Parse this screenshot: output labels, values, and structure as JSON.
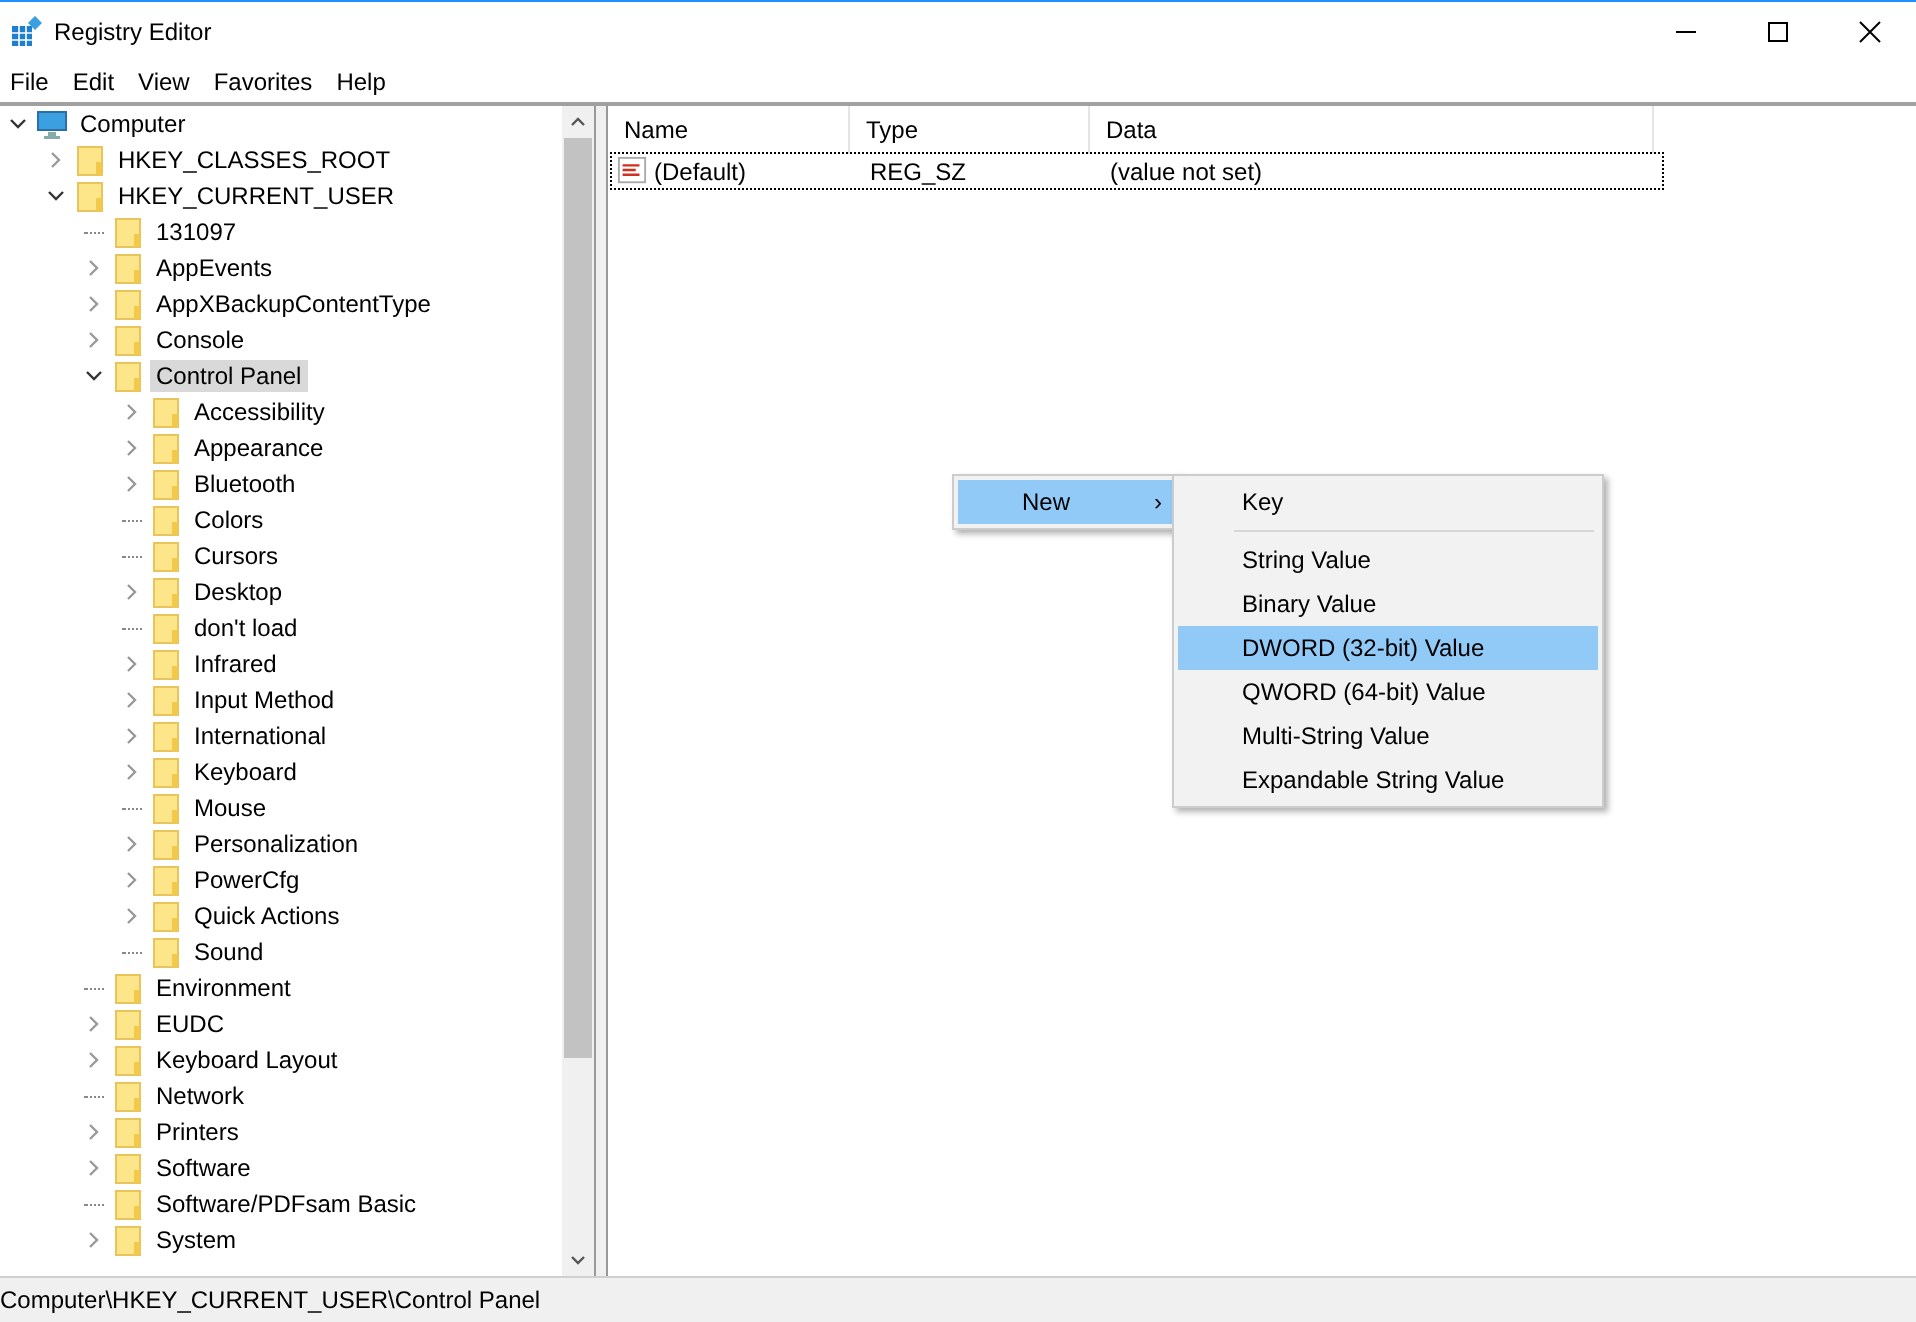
{
  "window": {
    "title": "Registry Editor"
  },
  "menu_bar": [
    "File",
    "Edit",
    "View",
    "Favorites",
    "Help"
  ],
  "tree": [
    {
      "label": "Computer",
      "kind": "computer",
      "expanded": true,
      "selected": false,
      "children": [
        {
          "label": "HKEY_CLASSES_ROOT",
          "kind": "folder",
          "expanded": false,
          "selected": false
        },
        {
          "label": "HKEY_CURRENT_USER",
          "kind": "folder",
          "expanded": true,
          "selected": false,
          "children": [
            {
              "label": "131097",
              "kind": "folder",
              "selected": false
            },
            {
              "label": "AppEvents",
              "kind": "folder",
              "expanded": false,
              "selected": false
            },
            {
              "label": "AppXBackupContentType",
              "kind": "folder",
              "expanded": false,
              "selected": false
            },
            {
              "label": "Console",
              "kind": "folder",
              "expanded": false,
              "selected": false
            },
            {
              "label": "Control Panel",
              "kind": "folder",
              "expanded": true,
              "selected": true,
              "children": [
                {
                  "label": "Accessibility",
                  "kind": "folder",
                  "expanded": false,
                  "selected": false
                },
                {
                  "label": "Appearance",
                  "kind": "folder",
                  "expanded": false,
                  "selected": false
                },
                {
                  "label": "Bluetooth",
                  "kind": "folder",
                  "expanded": false,
                  "selected": false
                },
                {
                  "label": "Colors",
                  "kind": "folder",
                  "selected": false
                },
                {
                  "label": "Cursors",
                  "kind": "folder",
                  "selected": false
                },
                {
                  "label": "Desktop",
                  "kind": "folder",
                  "expanded": false,
                  "selected": false
                },
                {
                  "label": "don't load",
                  "kind": "folder",
                  "selected": false
                },
                {
                  "label": "Infrared",
                  "kind": "folder",
                  "expanded": false,
                  "selected": false
                },
                {
                  "label": "Input Method",
                  "kind": "folder",
                  "expanded": false,
                  "selected": false
                },
                {
                  "label": "International",
                  "kind": "folder",
                  "expanded": false,
                  "selected": false
                },
                {
                  "label": "Keyboard",
                  "kind": "folder",
                  "expanded": false,
                  "selected": false
                },
                {
                  "label": "Mouse",
                  "kind": "folder",
                  "selected": false
                },
                {
                  "label": "Personalization",
                  "kind": "folder",
                  "expanded": false,
                  "selected": false
                },
                {
                  "label": "PowerCfg",
                  "kind": "folder",
                  "expanded": false,
                  "selected": false
                },
                {
                  "label": "Quick Actions",
                  "kind": "folder",
                  "expanded": false,
                  "selected": false
                },
                {
                  "label": "Sound",
                  "kind": "folder",
                  "selected": false
                }
              ]
            },
            {
              "label": "Environment",
              "kind": "folder",
              "selected": false
            },
            {
              "label": "EUDC",
              "kind": "folder",
              "expanded": false,
              "selected": false
            },
            {
              "label": "Keyboard Layout",
              "kind": "folder",
              "expanded": false,
              "selected": false
            },
            {
              "label": "Network",
              "kind": "folder",
              "selected": false
            },
            {
              "label": "Printers",
              "kind": "folder",
              "expanded": false,
              "selected": false
            },
            {
              "label": "Software",
              "kind": "folder",
              "expanded": false,
              "selected": false
            },
            {
              "label": "Software/PDFsam Basic",
              "kind": "folder",
              "selected": false
            },
            {
              "label": "System",
              "kind": "folder",
              "expanded": false,
              "selected": false
            }
          ]
        }
      ]
    }
  ],
  "table": {
    "columns": [
      "Name",
      "Type",
      "Data"
    ],
    "rows": [
      {
        "name": "(Default)",
        "type": "REG_SZ",
        "data": "(value not set)",
        "focused": true
      }
    ]
  },
  "context_menu": {
    "items": [
      {
        "label": "New",
        "arrow": "›",
        "selected": true
      }
    ]
  },
  "submenu": {
    "items": [
      {
        "kind": "item",
        "label": "Key",
        "selected": false
      },
      {
        "kind": "separator"
      },
      {
        "kind": "item",
        "label": "String Value",
        "selected": false
      },
      {
        "kind": "item",
        "label": "Binary Value",
        "selected": false
      },
      {
        "kind": "item",
        "label": "DWORD (32-bit) Value",
        "selected": true
      },
      {
        "kind": "item",
        "label": "QWORD (64-bit) Value",
        "selected": false
      },
      {
        "kind": "item",
        "label": "Multi-String Value",
        "selected": false
      },
      {
        "kind": "item",
        "label": "Expandable String Value",
        "selected": false
      }
    ]
  },
  "status_bar": "Computer\\HKEY_CURRENT_USER\\Control Panel"
}
